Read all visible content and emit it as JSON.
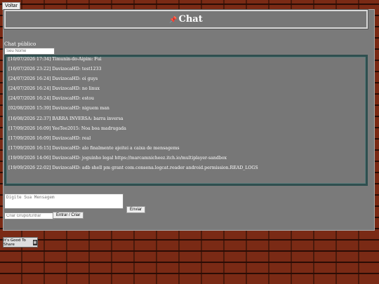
{
  "back_button": {
    "label": "Voltar"
  },
  "header": {
    "title": "Chat",
    "icon": "pushpin-icon"
  },
  "public_chat": {
    "label": "Chat público"
  },
  "name_input": {
    "placeholder": "Seu Nome"
  },
  "messages": [
    {
      "text": "[10/07/2026 17:34] Timunin-do-Aipim: Fui"
    },
    {
      "text": "[16/07/2026 23:22] DavizocaHD: test1233"
    },
    {
      "text": "[24/07/2026 16:24] DavizocaHD: oi guys"
    },
    {
      "text": "[24/07/2026 16:24] DavizocaHD: no linux"
    },
    {
      "text": "[24/07/2026 16:24] DavizocaHD: estou"
    },
    {
      "text": "[02/08/2026 15:39] DavizocaHD: niguem man"
    },
    {
      "text": "[16/08/2026 22:37] BARRA INVERSA: barra inversa"
    },
    {
      "text": "[17/09/2026 16:09] YeeTee2015: Noa boa madrugada"
    },
    {
      "text": "[17/09/2026 16:09] DavizocaHD: real"
    },
    {
      "text": "[17/09/2026 16:15] DavizocaHD: alo finalmente ajeitei a caixa de mensagems"
    },
    {
      "text": "[19/09/2026 14:06] DavizocaHD: joguinho legal https://marcamnicheez.itch.io/multiplayer-sandbox"
    },
    {
      "text": "[19/09/2026 22:02] DavizocaHD: adb shell pm grant com.consena.logcat.reader android.permission.READ_LOGS"
    }
  ],
  "message_input": {
    "placeholder": "Digite Sua Mensagem"
  },
  "send_button": {
    "label": "Enviar"
  },
  "group_input": {
    "placeholder": "Criar Grupo/Entrar"
  },
  "group_button": {
    "label": "Entrar / Criar"
  },
  "share_badge": {
    "text": "It's Good To Share"
  }
}
